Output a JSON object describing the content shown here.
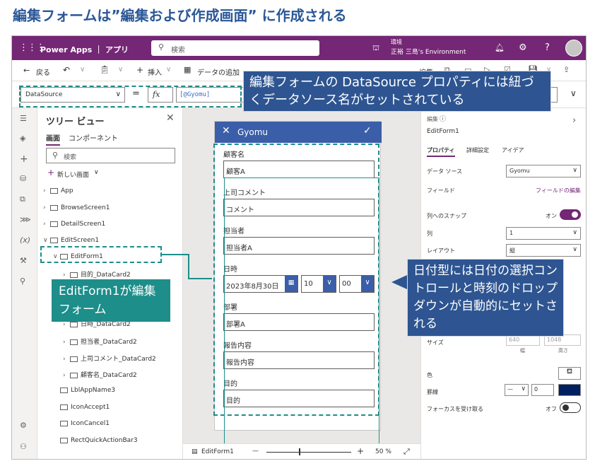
{
  "heading": "編集フォームは”編集および作成画面” に作成される",
  "topbar": {
    "app_title": "Power Apps ｜ アプリ",
    "search_placeholder": "検索",
    "env_label": "環境",
    "env_name": "正裕 三島's Environment"
  },
  "cmdbar": {
    "back": "戻る",
    "insert": "挿入",
    "add_data": "データの追加",
    "edit": "編集"
  },
  "formula_bar": {
    "property": "DataSource",
    "equals": "=",
    "fx": "fx",
    "formula": "[@Gyomu]"
  },
  "tree": {
    "title": "ツリー ビュー",
    "tab_screens": "画面",
    "tab_components": "コンポーネント",
    "search_placeholder": "検索",
    "new_screen": "新しい画面",
    "items": [
      "App",
      "BrowseScreen1",
      "DetailScreen1",
      "EditScreen1",
      "EditForm1",
      "目的_DataCard2",
      "日時_DataCard2",
      "担当者_DataCard2",
      "上司コメント_DataCard2",
      "顧客名_DataCard2",
      "LblAppName3",
      "IconAccept1",
      "IconCancel1",
      "RectQuickActionBar3"
    ]
  },
  "form": {
    "header_title": "Gyomu",
    "fields": [
      {
        "label": "顧客名",
        "value": "顧客A"
      },
      {
        "label": "上司コメント",
        "value": "コメント"
      },
      {
        "label": "担当者",
        "value": "担当者A"
      }
    ],
    "date_label": "日時",
    "date_value": "2023年8月30日",
    "hour_value": "10",
    "minute_value": "00",
    "fields2": [
      {
        "label": "部署",
        "value": "部署A"
      },
      {
        "label": "報告内容",
        "value": "報告内容"
      },
      {
        "label": "目的",
        "value": "目的"
      }
    ]
  },
  "canvas_footer": {
    "name": "EditForm1",
    "minus": "—",
    "plus": "+",
    "zoom": "50 %"
  },
  "props": {
    "type": "編集",
    "name": "EditForm1",
    "tabs": [
      "プロパティ",
      "詳細設定",
      "アイデア"
    ],
    "datasource_label": "データ ソース",
    "datasource_value": "Gyomu",
    "fields_label": "フィールド",
    "fields_link": "フィールドの編集",
    "snap_label": "列へのスナップ",
    "snap_value": "オン",
    "columns_label": "列",
    "columns_value": "1",
    "layout_label": "レイアウト",
    "layout_value": "縦",
    "size_label": "サイズ",
    "width_value": "640",
    "height_value": "1048",
    "width_label": "幅",
    "height_label": "高さ",
    "color_label": "色",
    "border_label": "罫線",
    "border_style": "—",
    "border_width": "0",
    "focus_label": "フォーカスを受け取る",
    "focus_value": "オフ"
  },
  "callouts": {
    "datasource_note": "編集フォームの DataSource プロパティには紐づくデータソース名がセットされている",
    "editform_note": "EditForm1が編集フォーム",
    "date_note": "日付型には日付の選択コントロールと時刻のドロップダウンが自動的にセットされる"
  },
  "colors": {
    "heading": "#2b5797",
    "topbar": "#742774",
    "callout": "#2e5591",
    "green": "#1d8e8a",
    "form_header": "#3b5ea8",
    "border_color": "#002060"
  }
}
